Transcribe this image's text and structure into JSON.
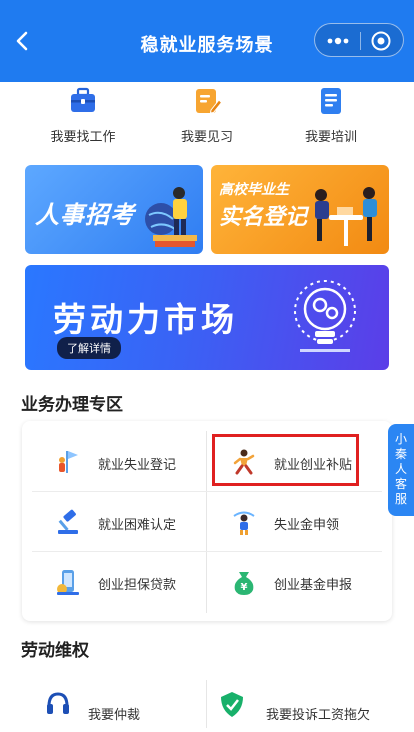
{
  "header": {
    "title": "稳就业服务场景",
    "background_color": "#1f7bf0",
    "back_icon": "chevron-left-icon",
    "more_icon": "more-dots-icon",
    "close_icon": "target-circle-icon"
  },
  "quick_links": [
    {
      "label": "我要找工作",
      "icon": "briefcase-icon"
    },
    {
      "label": "我要见习",
      "icon": "edit-note-icon"
    },
    {
      "label": "我要培训",
      "icon": "book-icon"
    }
  ],
  "banners": {
    "talent": {
      "text": "人事招考"
    },
    "graduates": {
      "line1": "高校毕业生",
      "line2": "实名登记"
    },
    "labor_market": {
      "title": "劳动力市场",
      "button": "了解详情"
    }
  },
  "business_section": {
    "title": "业务办理专区",
    "items": [
      {
        "label": "就业失业登记",
        "icon": "flag-person-icon"
      },
      {
        "label": "就业创业补贴",
        "icon": "running-person-icon"
      },
      {
        "label": "就业困难认定",
        "icon": "gavel-icon"
      },
      {
        "label": "失业金申领",
        "icon": "worker-icon"
      },
      {
        "label": "创业担保贷款",
        "icon": "phone-coin-icon"
      },
      {
        "label": "创业基金申报",
        "icon": "money-bag-icon"
      }
    ],
    "highlight_color": "#e02020"
  },
  "rights_section": {
    "title": "劳动维权",
    "items": [
      {
        "label": "我要仲裁",
        "icon": "headset-icon"
      },
      {
        "label": "我要投诉工资拖欠",
        "icon": "shield-icon"
      }
    ]
  },
  "customer_service": {
    "chars": [
      "小",
      "秦",
      "人",
      "客",
      "服"
    ]
  }
}
